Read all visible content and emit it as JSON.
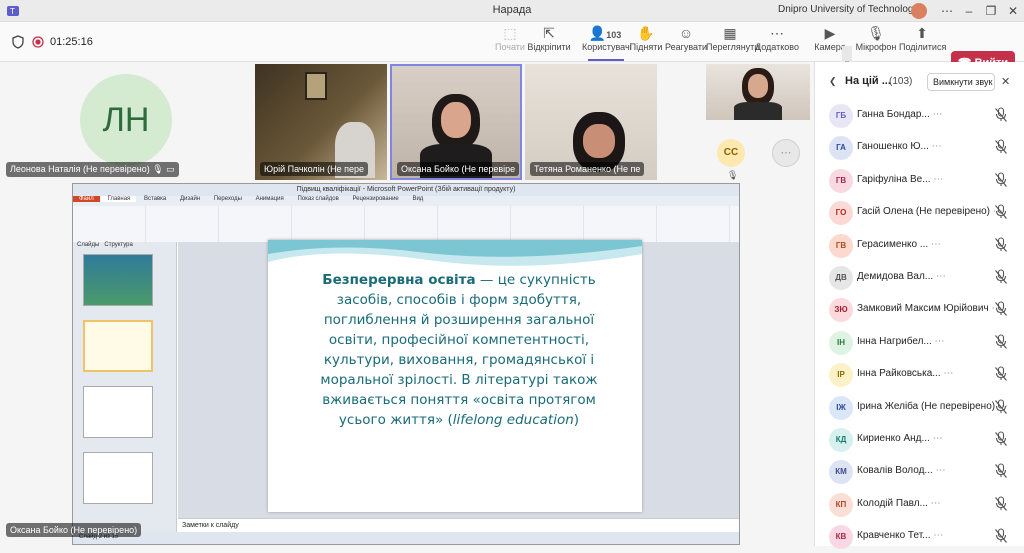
{
  "window": {
    "title": "Нарада",
    "org": "Dnipro University of Technology"
  },
  "toolbar": {
    "timer": "01:25:16",
    "buttons": [
      {
        "label": "Почати",
        "icon": "record-icon"
      },
      {
        "label": "Відкріпити",
        "icon": "unpin-icon"
      },
      {
        "label": "Користувачі",
        "icon": "people-icon",
        "count": "103"
      },
      {
        "label": "Підняти",
        "icon": "raise-hand-icon"
      },
      {
        "label": "Реагувати",
        "icon": "react-icon"
      },
      {
        "label": "Переглянути",
        "icon": "view-icon"
      },
      {
        "label": "Додатково",
        "icon": "more-icon"
      },
      {
        "label": "Камера",
        "icon": "camera-icon"
      },
      {
        "label": "Мікрофон",
        "icon": "mic-off-icon"
      },
      {
        "label": "Поділитися",
        "icon": "share-icon"
      }
    ],
    "leave": "Вийти"
  },
  "stage": {
    "avatar_initials": "ЛН",
    "tiles": [
      {
        "name": "Леонова Наталія (Не перевірено)"
      },
      {
        "name": "Юрій Пачколін (Не пере"
      },
      {
        "name": "Оксана Бойко (Не перевіре"
      },
      {
        "name": "Тетяна Романенко (Не пе"
      }
    ],
    "cc_initials": "СС",
    "presenter": "Оксана Бойко (Не перевірено)"
  },
  "ppt": {
    "title": "Підвищ кваліфікації - Microsoft PowerPoint (Збій активації продукту)",
    "tabs": [
      "Файл",
      "Главная",
      "Вставка",
      "Дизайн",
      "Переходы",
      "Анимация",
      "Показ слайдов",
      "Рецензирование",
      "Вид"
    ],
    "panes": [
      "Слайды",
      "Структура"
    ],
    "notes": "Заметки к слайду",
    "status": "Слайд 2 из 15"
  },
  "slide": {
    "bold": "Безперервна освіта",
    "text1": " — це сукупність засобів, способів і форм здобуття, поглиблення й розширення загальної освіти, професійної компетентності, культури, виховання, громадянської і моральної зрілості. В літературі також вживається поняття «освіта протягом усього життя» (",
    "italic": "lifelong education",
    "text2": ")"
  },
  "panel": {
    "title": "На цій ...",
    "count": "(103)",
    "mute_all": "Вимкнути звук ...",
    "people": [
      {
        "initials": "ГБ",
        "name": "Ганна Бондар...",
        "bg": "#e8e6f5",
        "fg": "#5b5fc7"
      },
      {
        "initials": "ГА",
        "name": "Ганошенко Ю...",
        "bg": "#dce3f5",
        "fg": "#2b4c9e"
      },
      {
        "initials": "ГВ",
        "name": "Гаріфуліна Ве...",
        "bg": "#f8d8e1",
        "fg": "#a8284a"
      },
      {
        "initials": "ГО",
        "name": "Гасій Олена (Не перевірено)",
        "bg": "#fbdad5",
        "fg": "#b0281a"
      },
      {
        "initials": "ГВ",
        "name": "Герасименко ...",
        "bg": "#fbd9cf",
        "fg": "#b04a1a"
      },
      {
        "initials": "ДВ",
        "name": "Демидова Вал...",
        "bg": "#e6e6e6",
        "fg": "#555555"
      },
      {
        "initials": "ЗЮ",
        "name": "Замковий Максим Юрійович",
        "bg": "#fadadd",
        "fg": "#a81a2e"
      },
      {
        "initials": "ІН",
        "name": "Інна Нагрибел...",
        "bg": "#dff3e4",
        "fg": "#2a7a3e"
      },
      {
        "initials": "ІР",
        "name": "Інна Райковська...",
        "bg": "#fdf1c7",
        "fg": "#8a6a00"
      },
      {
        "initials": "ІЖ",
        "name": "Ірина Желіба (Не перевірено)",
        "bg": "#dbe6f8",
        "fg": "#2b4c9e"
      },
      {
        "initials": "КД",
        "name": "Кириенко Анд...",
        "bg": "#d6f0ee",
        "fg": "#1a7a72"
      },
      {
        "initials": "КМ",
        "name": "Ковалів Волод...",
        "bg": "#dde3f3",
        "fg": "#3a4c8e"
      },
      {
        "initials": "КП",
        "name": "Колодій Павл...",
        "bg": "#fbded6",
        "fg": "#a8482a"
      },
      {
        "initials": "КВ",
        "name": "Кравченко Тет...",
        "bg": "#f9d8e3",
        "fg": "#a8284a"
      }
    ]
  }
}
